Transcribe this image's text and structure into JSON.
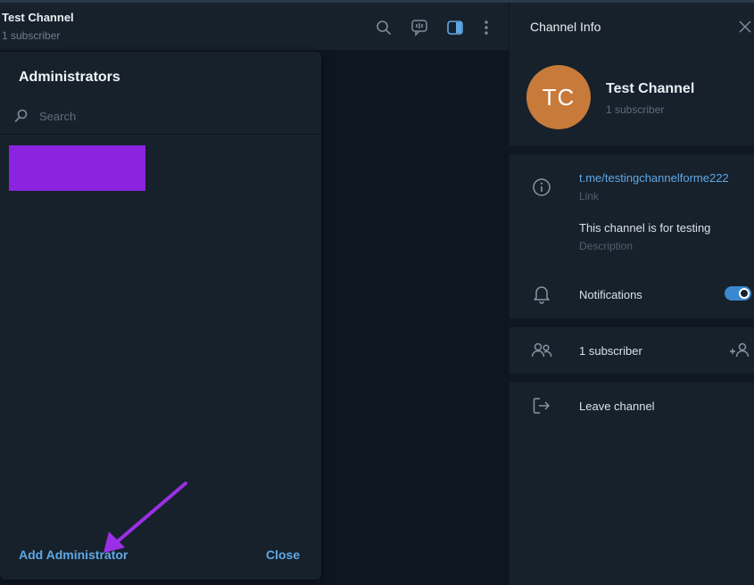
{
  "chat_header": {
    "title": "Test Channel",
    "subtitle": "1 subscriber",
    "icons": [
      "search-icon",
      "video-chat-icon",
      "sidebar-toggle-icon",
      "more-icon"
    ]
  },
  "info_panel": {
    "title": "Channel Info",
    "avatar_initials": "TC",
    "name": "Test Channel",
    "subscribers": "1 subscriber",
    "link": "t.me/testingchannelforme222",
    "link_label": "Link",
    "description": "This channel is for testing",
    "description_label": "Description",
    "notifications_label": "Notifications",
    "notifications_enabled": true,
    "subscribers_row": "1 subscriber",
    "leave_label": "Leave channel"
  },
  "modal": {
    "title": "Administrators",
    "search_placeholder": "Search",
    "add_admin_label": "Add Administrator",
    "close_label": "Close"
  },
  "colors": {
    "accent": "#5fa8e6",
    "avatar": "#c77a3a",
    "redaction": "#8b23e0",
    "annotation_arrow": "#9b2fe6"
  }
}
